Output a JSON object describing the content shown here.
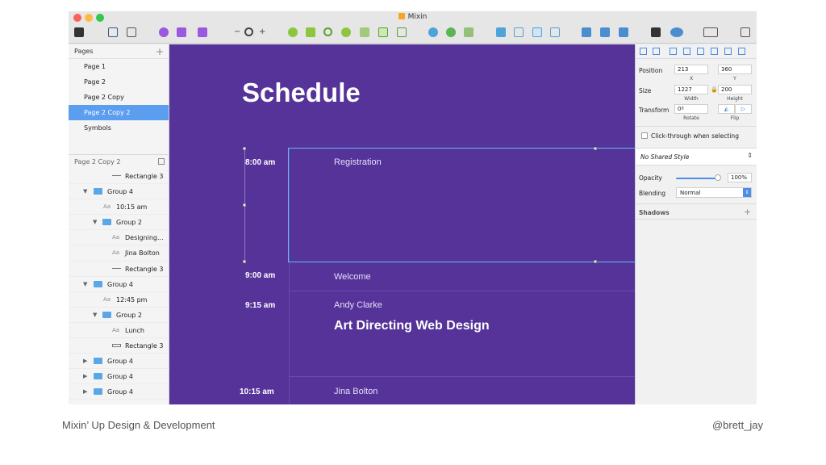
{
  "window": {
    "title": "Mixin"
  },
  "toolbar": {
    "icons": [
      "insert-icon",
      "group-icon",
      "ungroup-icon",
      "symbol-icon",
      "edit-icon",
      "text-icon",
      "zoom-icon",
      "union-icon",
      "subtract-icon",
      "rotate-icon",
      "mask-icon",
      "scissors-icon",
      "forward-icon",
      "backward-icon",
      "mirror-icon",
      "cloud-icon",
      "export-icon"
    ],
    "zoom_minus": "−",
    "zoom_plus": "+"
  },
  "pages": {
    "header": "Pages",
    "items": [
      {
        "label": "Page 1",
        "selected": false
      },
      {
        "label": "Page 2",
        "selected": false
      },
      {
        "label": "Page 2 Copy",
        "selected": false
      },
      {
        "label": "Page 2 Copy 2",
        "selected": true
      },
      {
        "label": "Symbols",
        "selected": false
      }
    ]
  },
  "layers": {
    "header": "Page 2 Copy 2",
    "items": [
      {
        "label": "Rectangle 3",
        "kind": "rect-line"
      },
      {
        "label": "Group 4",
        "kind": "group"
      },
      {
        "label": "10:15 am",
        "kind": "text"
      },
      {
        "label": "Group 2",
        "kind": "group"
      },
      {
        "label": "Designing...",
        "kind": "text"
      },
      {
        "label": "Jina Bolton",
        "kind": "text"
      },
      {
        "label": "Rectangle 3",
        "kind": "rect-line"
      },
      {
        "label": "Group 4",
        "kind": "group"
      },
      {
        "label": "12:45 pm",
        "kind": "text"
      },
      {
        "label": "Group 2",
        "kind": "group"
      },
      {
        "label": "Lunch",
        "kind": "text"
      },
      {
        "label": "Rectangle 3",
        "kind": "rect-hollow"
      },
      {
        "label": "Group 4",
        "kind": "group-collapsed"
      },
      {
        "label": "Group 4",
        "kind": "group-collapsed"
      },
      {
        "label": "Group 4",
        "kind": "group-collapsed"
      }
    ]
  },
  "canvas": {
    "title": "Schedule",
    "schedule": [
      {
        "time": "8:00 am",
        "event": "Registration"
      },
      {
        "time": "9:00 am",
        "event": "Welcome"
      },
      {
        "time": "9:15 am",
        "event": "Andy Clarke",
        "talk": "Art Directing Web Design"
      },
      {
        "time": "10:15 am",
        "event": "Jina Bolton"
      }
    ],
    "colors": {
      "background": "#553399",
      "selection": "#5fb8ff"
    }
  },
  "inspector": {
    "position_label": "Position",
    "x_value": "213",
    "y_value": "360",
    "x_sub": "X",
    "y_sub": "Y",
    "size_label": "Size",
    "width_value": "1227",
    "height_value": "200",
    "width_sub": "Width",
    "height_sub": "Height",
    "transform_label": "Transform",
    "rotate_value": "0º",
    "rotate_sub": "Rotate",
    "flip_sub": "Flip",
    "click_through": "Click-through when selecting",
    "shared_style": "No Shared Style",
    "opacity_label": "Opacity",
    "opacity_value": "100%",
    "opacity_level": 1.0,
    "blending_label": "Blending",
    "blending_value": "Normal",
    "shadows_label": "Shadows"
  },
  "footer": {
    "left": "Mixin’ Up Design & Development",
    "right": "@brett_jay"
  }
}
